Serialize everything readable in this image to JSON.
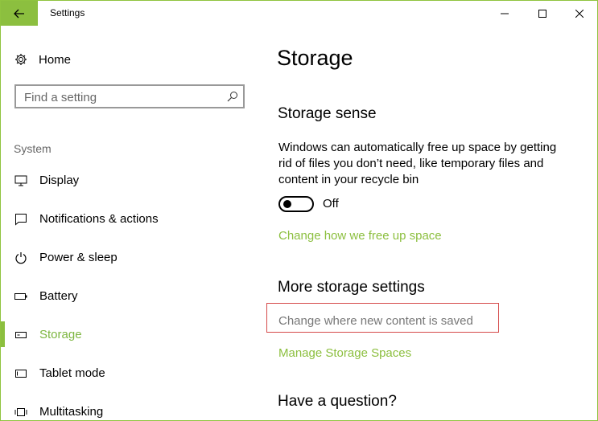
{
  "window": {
    "title": "Settings",
    "colors": {
      "accent": "#8cbf3f",
      "highlight_box": "#d54a4a"
    }
  },
  "sidebar": {
    "home_label": "Home",
    "search_placeholder": "Find a setting",
    "group_label": "System",
    "items": [
      {
        "label": "Display",
        "icon": "monitor-icon"
      },
      {
        "label": "Notifications & actions",
        "icon": "notification-icon"
      },
      {
        "label": "Power & sleep",
        "icon": "power-icon"
      },
      {
        "label": "Battery",
        "icon": "battery-icon"
      },
      {
        "label": "Storage",
        "icon": "storage-icon",
        "active": true
      },
      {
        "label": "Tablet mode",
        "icon": "tablet-icon"
      },
      {
        "label": "Multitasking",
        "icon": "multitasking-icon"
      }
    ]
  },
  "main": {
    "page_title": "Storage",
    "storage_sense": {
      "title": "Storage sense",
      "description": "Windows can automatically free up space by getting rid of files you don’t need, like temporary files and content in your recycle bin",
      "toggle_state": "Off",
      "link": "Change how we free up space"
    },
    "more": {
      "title": "More storage settings",
      "link_save": "Change where new content is saved",
      "link_spaces": "Manage Storage Spaces"
    },
    "question": {
      "title": "Have a question?"
    }
  }
}
